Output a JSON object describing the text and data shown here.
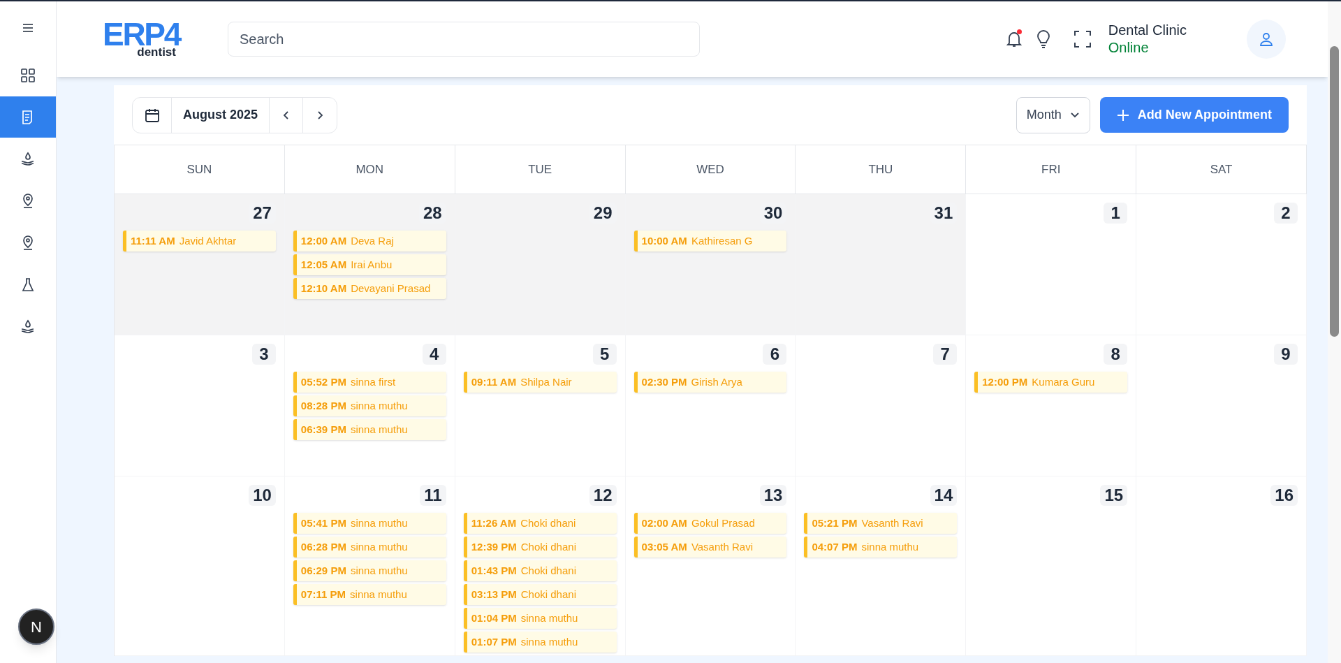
{
  "sidebar": {
    "items": [
      {
        "selected": false
      },
      {
        "selected": true
      },
      {
        "selected": false
      },
      {
        "selected": false
      },
      {
        "selected": false
      },
      {
        "selected": false
      },
      {
        "selected": false
      }
    ]
  },
  "header": {
    "logo": {
      "mark": "ERP4",
      "sub": "dentist"
    },
    "search": {
      "placeholder": "Search"
    },
    "notifications": {
      "unread": true
    },
    "account": {
      "name": "Dental Clinic",
      "status": "Online"
    }
  },
  "toolbar": {
    "period": "August 2025",
    "view": "Month",
    "add_button": "Add New Appointment"
  },
  "calendar": {
    "weekdays": [
      "SUN",
      "MON",
      "TUE",
      "WED",
      "THU",
      "FRI",
      "SAT"
    ],
    "weeks": [
      [
        {
          "day": "27",
          "in_month": false,
          "events": [
            {
              "time": "11:11 AM",
              "name": "Javid Akhtar"
            }
          ]
        },
        {
          "day": "28",
          "in_month": false,
          "events": [
            {
              "time": "12:00 AM",
              "name": "Deva Raj"
            },
            {
              "time": "12:05 AM",
              "name": "Irai Anbu"
            },
            {
              "time": "12:10 AM",
              "name": "Devayani Prasad"
            }
          ]
        },
        {
          "day": "29",
          "in_month": false
        },
        {
          "day": "30",
          "in_month": false,
          "events": [
            {
              "time": "10:00 AM",
              "name": "Kathiresan G"
            }
          ]
        },
        {
          "day": "31",
          "in_month": false
        },
        {
          "day": "1",
          "in_month": true
        },
        {
          "day": "2",
          "in_month": true
        }
      ],
      [
        {
          "day": "3",
          "in_month": true
        },
        {
          "day": "4",
          "in_month": true,
          "events": [
            {
              "time": "05:52 PM",
              "name": "sinna first"
            },
            {
              "time": "08:28 PM",
              "name": "sinna muthu"
            },
            {
              "time": "06:39 PM",
              "name": "sinna muthu"
            }
          ]
        },
        {
          "day": "5",
          "in_month": true,
          "events": [
            {
              "time": "09:11 AM",
              "name": "Shilpa Nair"
            }
          ]
        },
        {
          "day": "6",
          "in_month": true,
          "events": [
            {
              "time": "02:30 PM",
              "name": "Girish Arya"
            }
          ]
        },
        {
          "day": "7",
          "in_month": true
        },
        {
          "day": "8",
          "in_month": true,
          "events": [
            {
              "time": "12:00 PM",
              "name": "Kumara Guru"
            }
          ]
        },
        {
          "day": "9",
          "in_month": true
        }
      ],
      [
        {
          "day": "10",
          "in_month": true
        },
        {
          "day": "11",
          "in_month": true,
          "events": [
            {
              "time": "05:41 PM",
              "name": "sinna muthu"
            },
            {
              "time": "06:28 PM",
              "name": "sinna muthu"
            },
            {
              "time": "06:29 PM",
              "name": "sinna muthu"
            },
            {
              "time": "07:11 PM",
              "name": "sinna muthu"
            }
          ]
        },
        {
          "day": "12",
          "in_month": true,
          "events": [
            {
              "time": "11:26 AM",
              "name": "Choki dhani"
            },
            {
              "time": "12:39 PM",
              "name": "Choki dhani"
            },
            {
              "time": "01:43 PM",
              "name": "Choki dhani"
            },
            {
              "time": "03:13 PM",
              "name": "Choki dhani"
            },
            {
              "time": "01:04 PM",
              "name": "sinna muthu"
            },
            {
              "time": "01:07 PM",
              "name": "sinna muthu"
            }
          ]
        },
        {
          "day": "13",
          "in_month": true,
          "events": [
            {
              "time": "02:00 AM",
              "name": "Gokul Prasad"
            },
            {
              "time": "03:05 AM",
              "name": "Vasanth Ravi"
            }
          ]
        },
        {
          "day": "14",
          "in_month": true,
          "events": [
            {
              "time": "05:21 PM",
              "name": "Vasanth Ravi"
            },
            {
              "time": "04:07 PM",
              "name": "sinna muthu"
            }
          ]
        },
        {
          "day": "15",
          "in_month": true
        },
        {
          "day": "16",
          "in_month": true
        }
      ]
    ]
  },
  "dev_badge": "N"
}
